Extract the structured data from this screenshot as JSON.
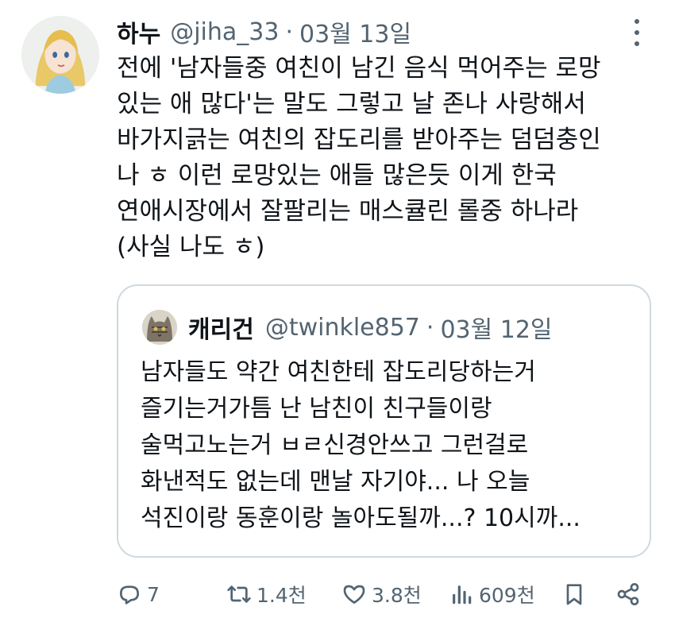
{
  "tweet": {
    "display_name": "하누",
    "handle": "@jiha_33",
    "separator": "·",
    "date": "03월 13일",
    "lines": [
      "전에 '남자들중 여친이 남긴 음식 먹어주는 로망",
      "있는 애 많다'는 말도 그렇고 날 존나 사랑해서",
      "바가지긁는 여친의 잡도리를 받아주는 덤덤충인",
      "나 ㅎ 이런 로망있는 애들 많은듯 이게 한국",
      "연애시장에서 잘팔리는 매스큘린 롤중 하나라",
      "(사실 나도 ㅎ)"
    ]
  },
  "quote": {
    "display_name": "캐리건",
    "handle": "@twinkle857",
    "separator": "·",
    "date": "03월 12일",
    "lines": [
      "남자들도 약간 여친한테 잡도리당하는거",
      "즐기는거가틈 난 남친이 친구들이랑",
      "술먹고노는거 ㅂㄹ신경안쓰고 그런걸로",
      "화낸적도 없는데 맨날 자기야... 나 오늘",
      "석진이랑 동훈이랑 놀아도될까...? 10시까..."
    ]
  },
  "actions": {
    "replies": "7",
    "retweets": "1.4천",
    "likes": "3.8천",
    "views": "609천"
  },
  "icons": {
    "more": "more-vertical-icon",
    "reply": "reply-icon",
    "retweet": "retweet-icon",
    "like": "heart-icon",
    "views": "views-chart-icon",
    "bookmark": "bookmark-icon",
    "share": "share-icon"
  },
  "colors": {
    "text": "#0f1419",
    "secondary": "#536471",
    "border": "#cfd9de"
  }
}
